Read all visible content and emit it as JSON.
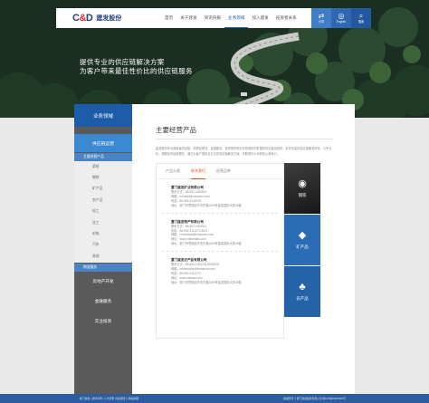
{
  "brand": {
    "mark_left": "C",
    "mark_amp": "&",
    "mark_right": "D",
    "name": "建发股份"
  },
  "nav": {
    "items": [
      {
        "label": "首页",
        "active": false
      },
      {
        "label": "关于建发",
        "active": false
      },
      {
        "label": "资讯快报",
        "active": false
      },
      {
        "label": "业务领域",
        "active": true
      },
      {
        "label": "加入建发",
        "active": false
      },
      {
        "label": "投资者关系",
        "active": false
      }
    ]
  },
  "tools": [
    {
      "icon": "share-icon",
      "glyph": "⇄",
      "label": "分享"
    },
    {
      "icon": "globe-icon",
      "glyph": "◎",
      "label": "English"
    },
    {
      "icon": "search-icon",
      "glyph": "⌕",
      "label": "搜索"
    }
  ],
  "hero": {
    "line1": "提供专业的供应链解决方案",
    "line2": "为客户带来最佳性价比的供应链服务"
  },
  "sidebar": {
    "title": "业务领域",
    "section": "供应链运营",
    "subsection": "主要经营产品",
    "products": [
      "浆纸",
      "钢铁",
      "矿产品",
      "农产品",
      "轻工",
      "化工",
      "机电",
      "汽车",
      "其他"
    ],
    "groups": [
      "物流服务",
      "房地产开发",
      "金融服务",
      "实业投资"
    ]
  },
  "main": {
    "title": "主要经营产品",
    "intro": "建发股份作为国家级供应链、商贸及物流、金融服务、投资等多种业务领域协同发展的供应链运营商，依托完善的供应链服务体系，以专业化、规模化的经营理念，通过为客户提供全方位的供应链解决方案，不断提升公司的核心竞争力。"
  },
  "tabs": [
    {
      "label": "产品分类",
      "active": false
    },
    {
      "label": "联系我们",
      "active": true
    },
    {
      "label": "经营品种",
      "active": false
    }
  ],
  "companies": [
    {
      "name": "厦门建发矿业有限公司",
      "phone": "联系方式：86-592-2263919",
      "email": "邮箱：mineral@chinacnd.com",
      "fax": "传真：86-592-2132678",
      "address": "地址：厦门市思明区环岛东路1699号建发国际大厦25楼"
    },
    {
      "name": "厦门建发物产有限公司",
      "phone": "联系方式：86-592-2263911",
      "fax": "传真：86-592-2111272-5811",
      "email": "邮箱：cndmetals@chinacnd.com",
      "web": "网址：www.cndmetals.com",
      "address": "地址：厦门市思明区环岛东路1699号建发国际大厦26楼"
    },
    {
      "name": "厦门建发农产品有限公司",
      "phone": "联系方式：86-592-2263223,2624528",
      "email": "邮箱：cndoutdoor@chinacnd.com",
      "fax": "传真：86-592-2111273",
      "web": "网址：www.cndstar.com",
      "address": "地址：厦门市思明区环岛东路1699号建发国际大厦25楼"
    }
  ],
  "categories": [
    {
      "icon": "steel-coil-icon",
      "glyph": "◉",
      "label": "钢铁"
    },
    {
      "icon": "mineral-icon",
      "glyph": "◆",
      "label": "矿产品"
    },
    {
      "icon": "wheat-icon",
      "glyph": "♣",
      "label": "农产品"
    }
  ],
  "footer": {
    "left": "厦门建发 | 法律声明 | 人才招聘 | 联系我们 | 网站地图",
    "right": "版权所有 © 厦门建发股份有限公司 闽ICP备05000383号"
  }
}
